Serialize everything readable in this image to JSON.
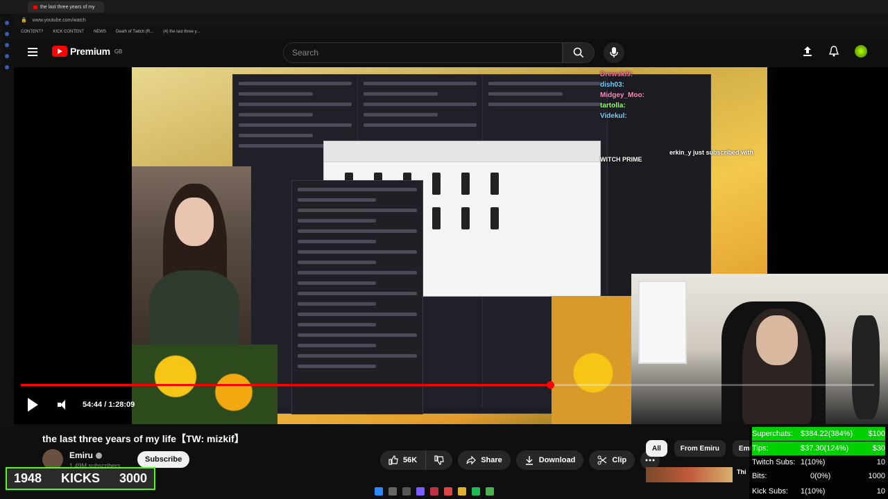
{
  "browser": {
    "tab_title": "the last three years of my",
    "url": "www.youtube.com/watch",
    "bookmarks": [
      "CONTENT?",
      "KICK CONTENT",
      "NEWS",
      "Death of Twitch (R...",
      "(4) the last three y..."
    ]
  },
  "header": {
    "logo_text": "Premium",
    "logo_region": "GB",
    "search_placeholder": "Search"
  },
  "video": {
    "overlay_chat": [
      {
        "name": "Drewski9:"
      },
      {
        "name": "dish03:"
      },
      {
        "name": "Midgey_Moo:"
      },
      {
        "name": "tartolla:"
      },
      {
        "name": "Videkul:"
      }
    ],
    "sub_alert": "erkin_y just subscribed with",
    "sub_alert_line2": "WITCH PRIME",
    "time_current": "54:44",
    "time_total": "1:28:09",
    "progress_fraction": 0.62
  },
  "below": {
    "title": "the last three years of my life【TW: mizkif】",
    "channel": "Emiru",
    "subscribers": "1.49M subscribers",
    "subscribe_label": "Subscribe",
    "likes": "56K",
    "share_label": "Share",
    "download_label": "Download",
    "clip_label": "Clip"
  },
  "chips": [
    "All",
    "From Emiru",
    "Emiru"
  ],
  "thumb_title": "Thi",
  "kick": {
    "current": "1948",
    "label": "KICKS",
    "goal": "3000"
  },
  "stats": [
    {
      "label": "Superchats:",
      "value": "$384.22(384%)",
      "goal": "$100",
      "highlight": true
    },
    {
      "label": "Tips:",
      "value": "$37.30(124%)",
      "goal": "$30",
      "highlight": true
    },
    {
      "label": "Twitch Subs:",
      "value": "1(10%)",
      "goal": "10",
      "highlight": false
    },
    {
      "label": "Bits:",
      "value": "0(0%)",
      "goal": "1000",
      "highlight": false
    },
    {
      "label": "Kick Subs:",
      "value": "1(10%)",
      "goal": "10",
      "highlight": false
    }
  ],
  "colors": {
    "accent_red": "#ff0000",
    "kick_green": "#53fc18",
    "stat_green": "#00d000"
  }
}
